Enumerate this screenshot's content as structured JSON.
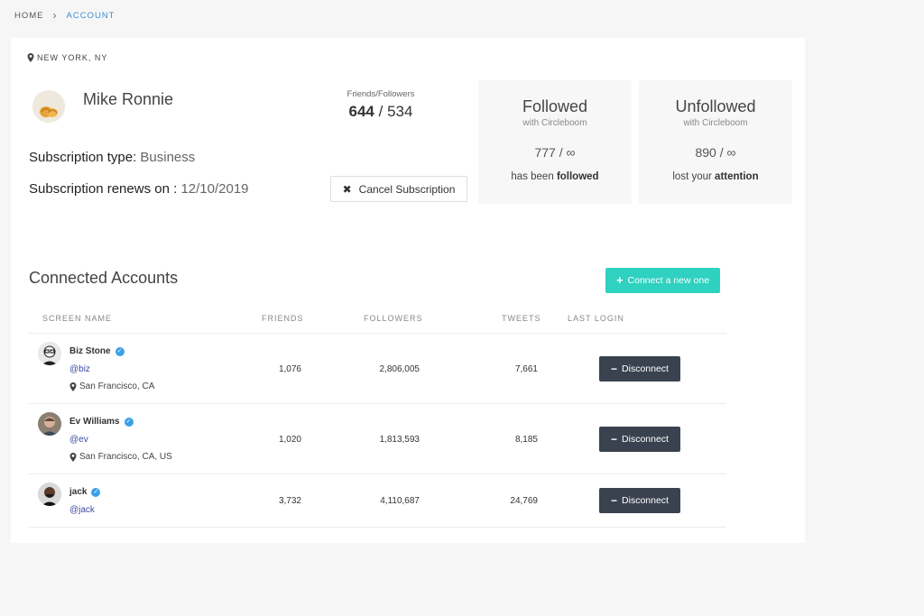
{
  "breadcrumb": {
    "home": "HOME",
    "separator": "›",
    "current": "ACCOUNT"
  },
  "profile": {
    "location": "NEW YORK, NY",
    "name": "Mike Ronnie",
    "subscription_type_label": "Subscription type:",
    "subscription_type_value": "Business",
    "renews_label": "Subscription renews on :",
    "renews_value": "12/10/2019",
    "friends_followers_label": "Friends/Followers",
    "friends": "644",
    "followers_sep": "/",
    "followers": "534",
    "cancel_label": "Cancel Subscription"
  },
  "stats": {
    "followed": {
      "title": "Followed",
      "sub": "with Circleboom",
      "count": "777 / ∞",
      "note_prefix": "has been",
      "note_bold": "followed"
    },
    "unfollowed": {
      "title": "Unfollowed",
      "sub": "with Circleboom",
      "count": "890 / ∞",
      "note_prefix": "lost your",
      "note_bold": "attention"
    }
  },
  "connected": {
    "title": "Connected Accounts",
    "connect_label": "Connect a new one",
    "columns": {
      "name": "SCREEN NAME",
      "friends": "FRIENDS",
      "followers": "FOLLOWERS",
      "tweets": "TWEETS",
      "last_login": "LAST LOGIN"
    },
    "rows": [
      {
        "name": "Biz Stone",
        "handle": "@biz",
        "location": "San Francisco, CA",
        "friends": "1,076",
        "followers": "2,806,005",
        "tweets": "7,661",
        "action": "Disconnect"
      },
      {
        "name": "Ev Williams",
        "handle": "@ev",
        "location": "San Francisco, CA, US",
        "friends": "1,020",
        "followers": "1,813,593",
        "tweets": "8,185",
        "action": "Disconnect"
      },
      {
        "name": "jack",
        "handle": "@jack",
        "location": "",
        "friends": "3,732",
        "followers": "4,110,687",
        "tweets": "24,769",
        "action": "Disconnect"
      }
    ]
  },
  "colors": {
    "accent": "#3a8fd6",
    "connect_button": "#2fd1c0",
    "disconnect_button": "#3a4250",
    "verified": "#3aa0e8",
    "handle": "#3b4aa0"
  }
}
